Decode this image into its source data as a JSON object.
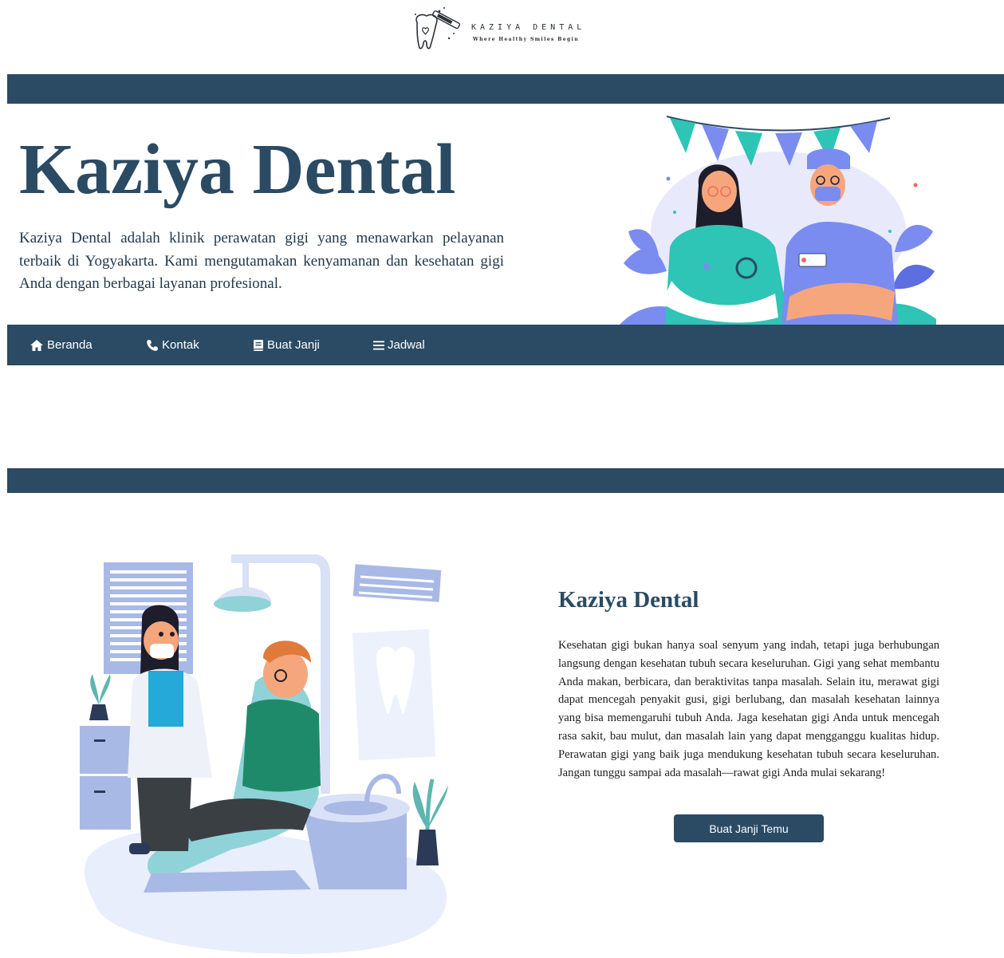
{
  "brand": {
    "logo_name": "KAZIYA DENTAL",
    "logo_tagline": "Where Healthy Smiles Begin"
  },
  "hero": {
    "title": "Kaziya Dental",
    "description": "Kaziya Dental adalah klinik perawatan gigi yang menawarkan pelayanan terbaik di Yogyakarta. Kami mengutamakan kenyamanan dan kesehatan gigi Anda dengan berbagai layanan profesional.",
    "illustration_icon": "dentist-team-illustration"
  },
  "nav": {
    "items": [
      {
        "label": "Beranda",
        "icon": "home-icon"
      },
      {
        "label": "Kontak",
        "icon": "phone-icon"
      },
      {
        "label": "Buat Janji",
        "icon": "book-icon"
      },
      {
        "label": "Jadwal",
        "icon": "menu-icon"
      }
    ]
  },
  "about": {
    "title": "Kaziya Dental",
    "text": "Kesehatan gigi bukan hanya soal senyum yang indah, tetapi juga berhubungan langsung dengan kesehatan tubuh secara keseluruhan. Gigi yang sehat membantu Anda makan, berbicara, dan beraktivitas tanpa masalah. Selain itu, merawat gigi dapat mencegah penyakit gusi, gigi berlubang, dan masalah kesehatan lainnya yang bisa memengaruhi tubuh Anda. Jaga kesehatan gigi Anda untuk mencegah rasa sakit, bau mulut, dan masalah lain yang dapat mengganggu kualitas hidup. Perawatan gigi yang baik juga mendukung kesehatan tubuh secara keseluruhan. Jangan tunggu sampai ada masalah—rawat gigi Anda mulai sekarang!",
    "cta_label": "Buat Janji Temu",
    "illustration_icon": "dental-clinic-illustration"
  },
  "colors": {
    "primary": "#2b4a63",
    "teal": "#2ec4b6",
    "periwinkle": "#7b8cf0",
    "background": "#ffffff"
  }
}
